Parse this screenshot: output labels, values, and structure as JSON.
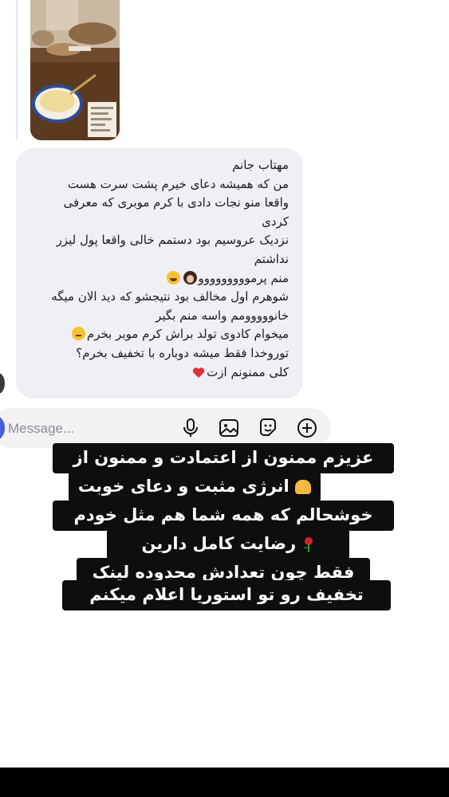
{
  "message": {
    "lines": [
      "مهتاب جانم",
      "من که همیشه دعای خیرم پشت سرت هست",
      "واقعا منو نجات دادی با کرم موبری که معرفی",
      "کردی",
      "نزدیک عروسیم بود دستمم خالی واقعا پول لیزر",
      "نداشتم",
      "منم پرمووووووووو",
      "شوهرم اول مخالف بود نتیجشو که دید الان میگه",
      "خانووووومم واسه منم بگیر",
      "میخوام کادوی تولد براش کرم موبر بخرم",
      "توروخدا فقط میشه دوباره با تخفیف بخرم؟",
      "کلی ممنونم ازت"
    ],
    "emojis": [
      "woman-icon",
      "laughing-icon",
      "smile-icon",
      "heart-icon"
    ]
  },
  "composer": {
    "placeholder": "Message...",
    "icons": [
      "microphone-icon",
      "gallery-icon",
      "sticker-icon",
      "plus-icon"
    ]
  },
  "overlay": {
    "lines": [
      "عزیزم ممنون از اعتمادت و ممنون از",
      "انرژی مثبت و دعای خوبت",
      "خوشحالم که همه شما هم مثل خودم",
      "رضایت کامل دارین",
      "فقط چون تعدادش محدوده لینک",
      "تخفیف رو  تو استوریا اعلام میکنم"
    ],
    "emojis": [
      "pray-icon",
      "rose-icon"
    ],
    "background": "#0e0e0e",
    "text_color": "#ffffff"
  },
  "colors": {
    "bubble": "#efeff4",
    "composer": "#f2f2f5",
    "avatar": "#4c5bdc"
  }
}
